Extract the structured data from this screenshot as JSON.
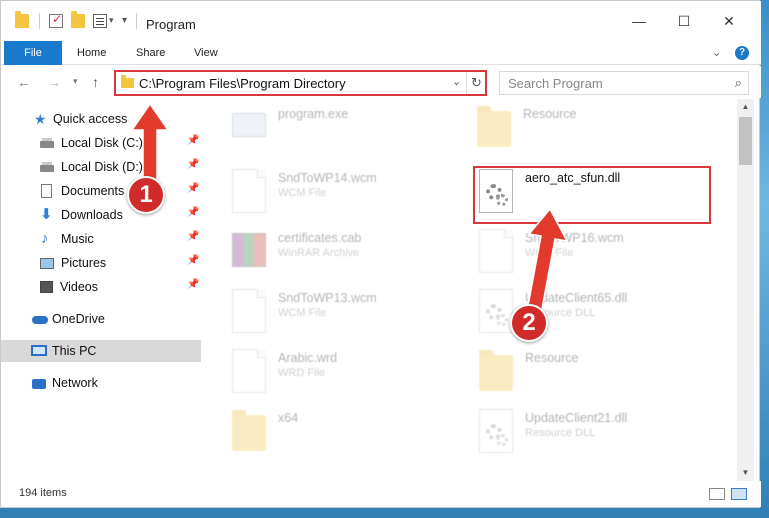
{
  "window": {
    "title": "Program"
  },
  "ribbon": {
    "tabs": [
      "File",
      "Home",
      "Share",
      "View"
    ],
    "help": "?"
  },
  "address": {
    "path": "C:\\Program Files\\Program Directory"
  },
  "search": {
    "placeholder": "Search Program"
  },
  "sidebar": {
    "items": [
      {
        "label": "Quick access",
        "pinned": false
      },
      {
        "label": "Local Disk (C:)",
        "pinned": true
      },
      {
        "label": "Local Disk (D:)",
        "pinned": true
      },
      {
        "label": "Documents",
        "pinned": true
      },
      {
        "label": "Downloads",
        "pinned": true
      },
      {
        "label": "Music",
        "pinned": true
      },
      {
        "label": "Pictures",
        "pinned": true
      },
      {
        "label": "Videos",
        "pinned": true
      },
      {
        "label": "OneDrive",
        "pinned": false
      },
      {
        "label": "This PC",
        "pinned": false
      },
      {
        "label": "Network",
        "pinned": false
      }
    ]
  },
  "files": [
    {
      "name": "program.exe",
      "type": "",
      "icon": "exe-icon",
      "faded": true
    },
    {
      "name": "Resource",
      "type": "",
      "icon": "folder-icon",
      "faded": true
    },
    {
      "name": "SndToWP14.wcm",
      "type": "WCM File",
      "icon": "file-icon",
      "faded": true
    },
    {
      "name": "aero_atc_sfun.dll",
      "type": "",
      "icon": "dll-icon",
      "faded": false
    },
    {
      "name": "certificates.cab",
      "type": "WinRAR Archive",
      "icon": "rar-icon",
      "faded": true
    },
    {
      "name": "SndToWP16.wcm",
      "type": "WCM File",
      "icon": "file-icon",
      "faded": true
    },
    {
      "name": "SndToWP13.wcm",
      "type": "WCM File",
      "icon": "file-icon",
      "faded": true
    },
    {
      "name": "UpdateClient65.dll",
      "type": "Resource DLL",
      "icon": "dll-icon",
      "faded": true
    },
    {
      "name": "Arabic.wrd",
      "type": "WRD File",
      "icon": "file-icon",
      "faded": true
    },
    {
      "name": "Resource",
      "type": "",
      "icon": "folder-icon",
      "faded": true
    },
    {
      "name": "x64",
      "type": "",
      "icon": "folder-icon",
      "faded": true
    },
    {
      "name": "UpdateClient21.dll",
      "type": "Resource DLL",
      "icon": "dll-icon",
      "faded": true
    }
  ],
  "status": {
    "count": "194 items"
  },
  "annotations": {
    "step1": "1",
    "step2": "2"
  },
  "colors": {
    "accent": "#1979ca",
    "highlight": "#d9373b"
  }
}
